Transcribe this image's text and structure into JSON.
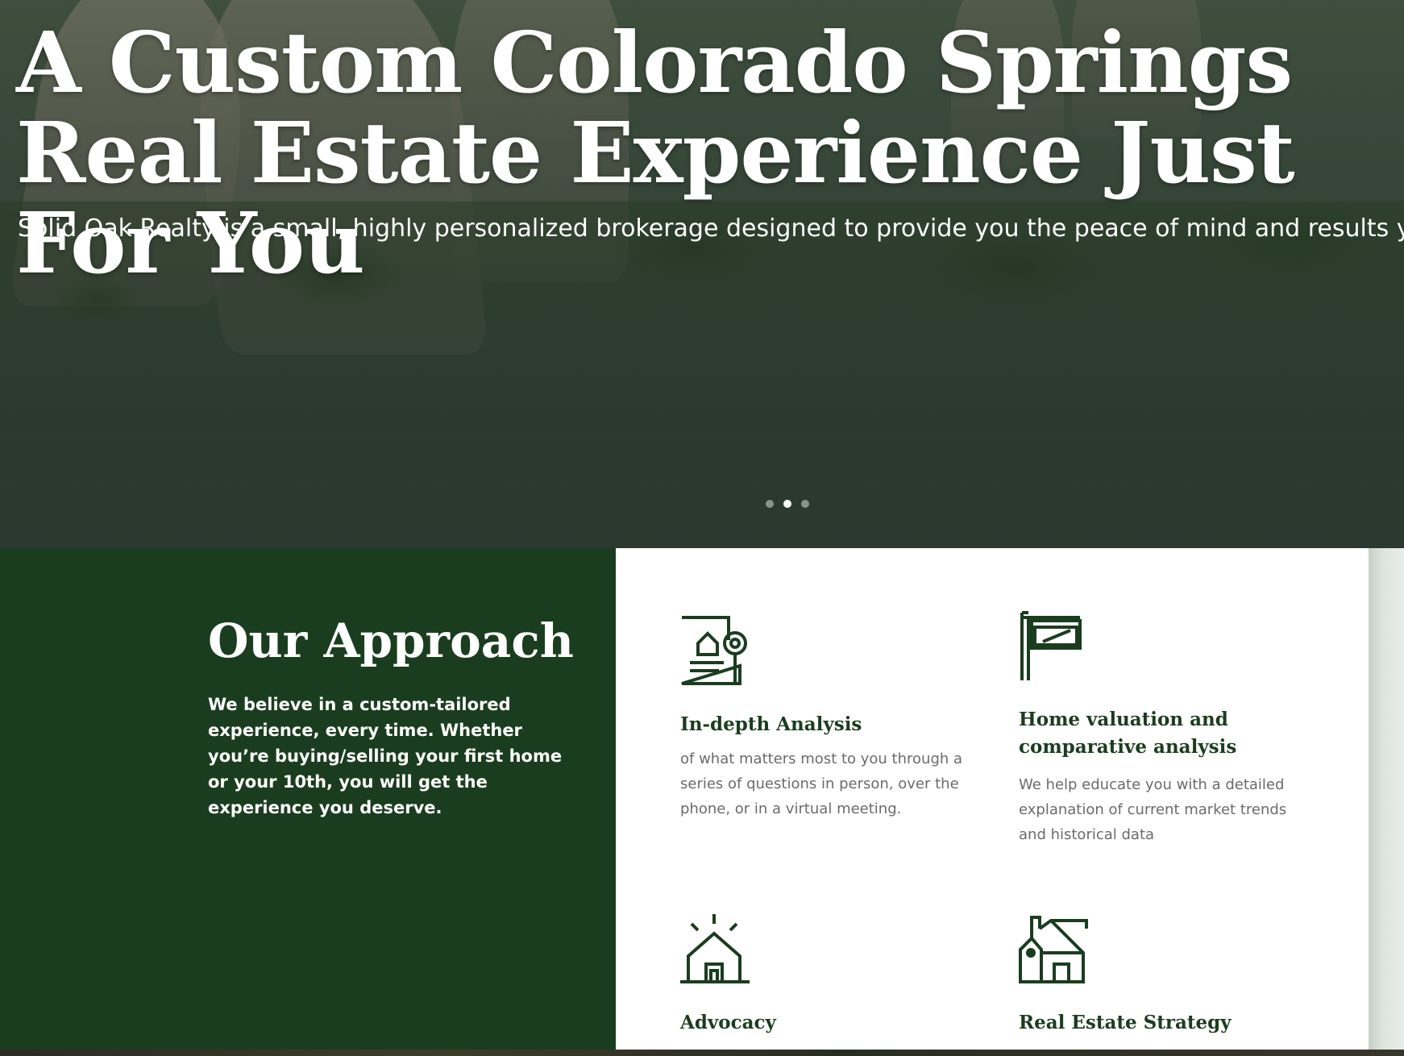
{
  "hero": {
    "title": "A Custom Colorado Springs Real Estate Experience Just For You",
    "subtitle": "Solid Oak Realty is a small, highly personalized brokerage designed to provide you the peace of mind and results you deserve.",
    "slider": {
      "total_dots": 3,
      "active_dot": 2
    }
  },
  "approach": {
    "title": "Our Approach",
    "text": "We believe in a custom-tailored experience, every time. Whether you’re buying/selling your first home or your 10th, you will get the experience you deserve.",
    "features": [
      {
        "icon": "house-document-search-icon",
        "title": "In-depth Analysis",
        "text": "of what matters most to you through a series of questions in person, over the phone, or in a virtual meeting."
      },
      {
        "icon": "for-sale-sign-icon",
        "title": "Home valuation and comparative analysis",
        "text": "We help educate you with a detailed explanation of current market trends and historical data"
      },
      {
        "icon": "house-shine-icon",
        "title": "Advocacy",
        "text": ""
      },
      {
        "icon": "house-tag-icon",
        "title": "Real Estate Strategy",
        "text": ""
      }
    ]
  },
  "colors": {
    "brand_green": "#1b3d1f",
    "text_gray": "#6b6b6b",
    "white": "#ffffff"
  }
}
